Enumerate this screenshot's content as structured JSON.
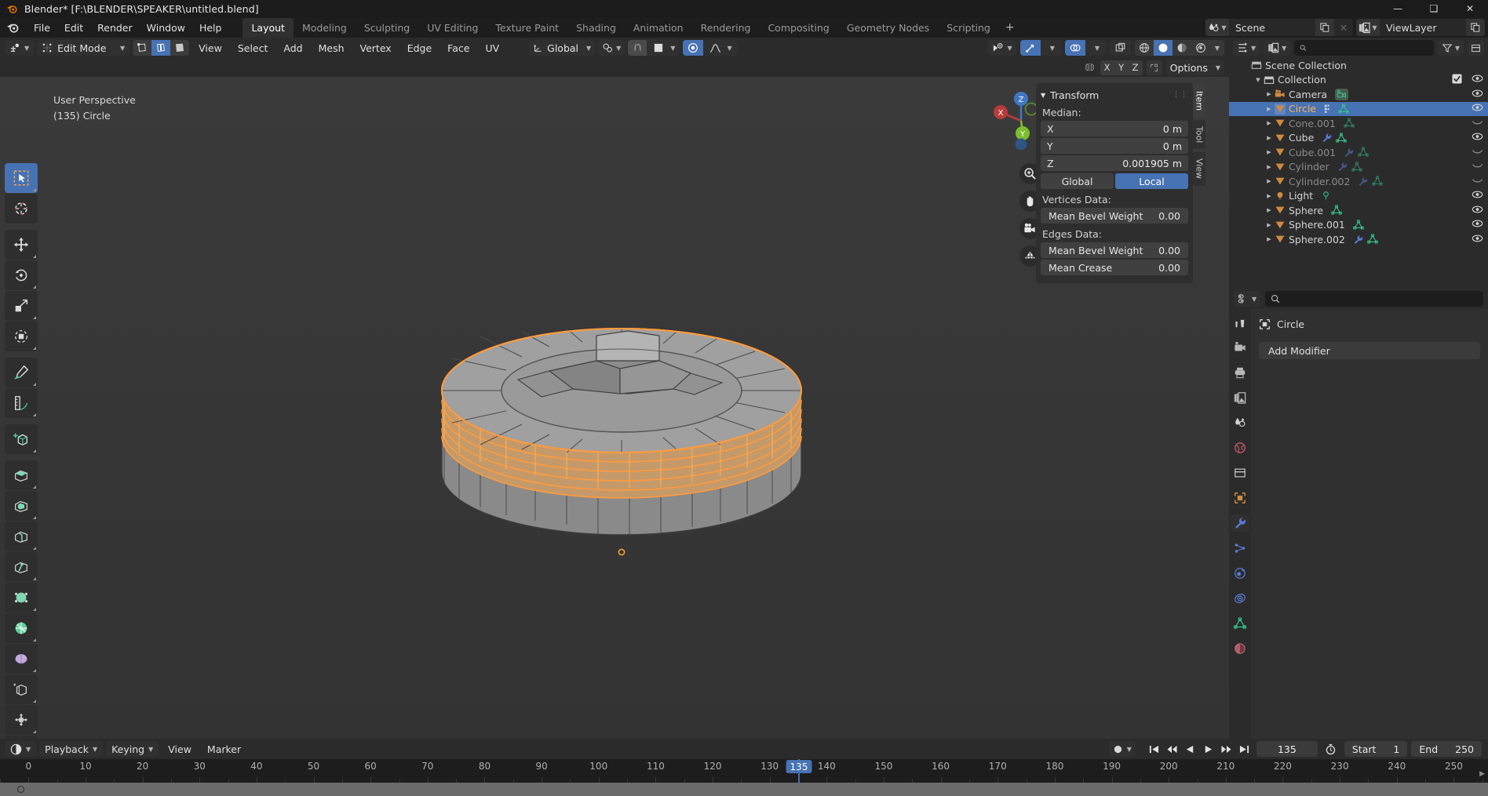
{
  "window": {
    "title": "Blender* [F:\\BLENDER\\SPEAKER\\untitled.blend]",
    "minimize": "—",
    "maximize": "❑",
    "close": "✕"
  },
  "topbar": {
    "menus": [
      "File",
      "Edit",
      "Render",
      "Window",
      "Help"
    ],
    "workspace_tabs": [
      "Layout",
      "Modeling",
      "Sculpting",
      "UV Editing",
      "Texture Paint",
      "Shading",
      "Animation",
      "Rendering",
      "Compositing",
      "Geometry Nodes",
      "Scripting"
    ],
    "active_workspace": "Layout",
    "add_workspace": "+",
    "scene_name": "Scene",
    "viewlayer_name": "ViewLayer"
  },
  "viewport_header": {
    "mode": "Edit Mode",
    "menus": [
      "View",
      "Select",
      "Add",
      "Mesh",
      "Vertex",
      "Edge",
      "Face",
      "UV"
    ],
    "transform_orientation": "Global",
    "select_modes": [
      "vertex-select",
      "edge-select",
      "face-select"
    ],
    "active_select_mode": "edge-select",
    "proportional_editing": "enabled",
    "options_label": "Options",
    "axis_buttons": [
      "X",
      "Y",
      "Z"
    ],
    "shading_modes": [
      "wireframe",
      "solid",
      "material-preview",
      "rendered"
    ],
    "active_shading": "solid"
  },
  "viewport": {
    "perspective_label": "User Perspective",
    "collection_label": "(135) Circle",
    "gizmo_axes": [
      "X",
      "Y",
      "Z"
    ]
  },
  "sidebar_tabs": [
    "Item",
    "Tool",
    "View"
  ],
  "active_sidebar_tab": "Item",
  "transform_panel": {
    "title": "Transform",
    "median_label": "Median:",
    "median": [
      {
        "axis": "X",
        "value": "0 m"
      },
      {
        "axis": "Y",
        "value": "0 m"
      },
      {
        "axis": "Z",
        "value": "0.001905 m"
      }
    ],
    "space_buttons": [
      "Global",
      "Local"
    ],
    "active_space": "Local",
    "vertices_data_label": "Vertices Data:",
    "vertices_rows": [
      {
        "key": "Mean Bevel Weight",
        "value": "0.00"
      }
    ],
    "edges_data_label": "Edges Data:",
    "edges_rows": [
      {
        "key": "Mean Bevel Weight",
        "value": "0.00"
      },
      {
        "key": "Mean Crease",
        "value": "0.00"
      }
    ]
  },
  "outliner": {
    "search_placeholder": "",
    "root": "Scene Collection",
    "collection": "Collection",
    "items": [
      {
        "name": "Camera",
        "type": "camera",
        "indent": 3,
        "selected": false,
        "dim": false,
        "visible": true,
        "icons": [
          "camera-data"
        ]
      },
      {
        "name": "Circle",
        "type": "mesh",
        "indent": 3,
        "selected": true,
        "dim": false,
        "visible": true,
        "icons": [
          "vertex-group",
          "mesh-data"
        ]
      },
      {
        "name": "Cone.001",
        "type": "mesh",
        "indent": 3,
        "selected": false,
        "dim": true,
        "visible": false,
        "icons": [
          "mesh-data"
        ]
      },
      {
        "name": "Cube",
        "type": "mesh",
        "indent": 3,
        "selected": false,
        "dim": false,
        "visible": true,
        "icons": [
          "modifier",
          "mesh-data"
        ]
      },
      {
        "name": "Cube.001",
        "type": "mesh",
        "indent": 3,
        "selected": false,
        "dim": true,
        "visible": false,
        "icons": [
          "modifier",
          "mesh-data"
        ]
      },
      {
        "name": "Cylinder",
        "type": "mesh",
        "indent": 3,
        "selected": false,
        "dim": true,
        "visible": false,
        "icons": [
          "modifier",
          "mesh-data"
        ]
      },
      {
        "name": "Cylinder.002",
        "type": "mesh",
        "indent": 3,
        "selected": false,
        "dim": true,
        "visible": false,
        "icons": [
          "modifier",
          "mesh-data"
        ]
      },
      {
        "name": "Light",
        "type": "light",
        "indent": 3,
        "selected": false,
        "dim": false,
        "visible": true,
        "icons": [
          "light-data"
        ]
      },
      {
        "name": "Sphere",
        "type": "mesh",
        "indent": 3,
        "selected": false,
        "dim": false,
        "visible": true,
        "icons": [
          "mesh-data"
        ]
      },
      {
        "name": "Sphere.001",
        "type": "mesh",
        "indent": 3,
        "selected": false,
        "dim": false,
        "visible": true,
        "icons": [
          "mesh-data"
        ]
      },
      {
        "name": "Sphere.002",
        "type": "mesh",
        "indent": 3,
        "selected": false,
        "dim": false,
        "visible": true,
        "icons": [
          "modifier",
          "mesh-data"
        ]
      }
    ]
  },
  "properties": {
    "search_placeholder": "",
    "breadcrumb": "Circle",
    "add_modifier": "Add Modifier",
    "tabs": [
      "tool",
      "render",
      "output",
      "viewlayer",
      "scene",
      "world",
      "collection",
      "object",
      "modifier",
      "particles",
      "physics",
      "constraints",
      "data",
      "material"
    ],
    "active_tab": "modifier"
  },
  "timeline": {
    "menus": [
      "Playback",
      "Keying",
      "View",
      "Marker"
    ],
    "current_frame": "135",
    "start_label": "Start",
    "start_value": "1",
    "end_label": "End",
    "end_value": "250",
    "ticks": [
      0,
      10,
      20,
      30,
      40,
      50,
      60,
      70,
      80,
      90,
      100,
      110,
      120,
      130,
      140,
      150,
      160,
      170,
      180,
      190,
      200,
      210,
      220,
      230,
      240,
      250
    ],
    "playhead_frame": 135,
    "frame_min": -5,
    "frame_max": 256
  },
  "colors": {
    "accent_blue": "#4772b3",
    "selection_orange": "#ffb152",
    "mesh_green": "#37c28e",
    "modifier_blue": "#5a7cd6",
    "object_orange": "#d08a3f",
    "panel_bg": "#2b2b2b",
    "viewport_bg": "#393939"
  }
}
